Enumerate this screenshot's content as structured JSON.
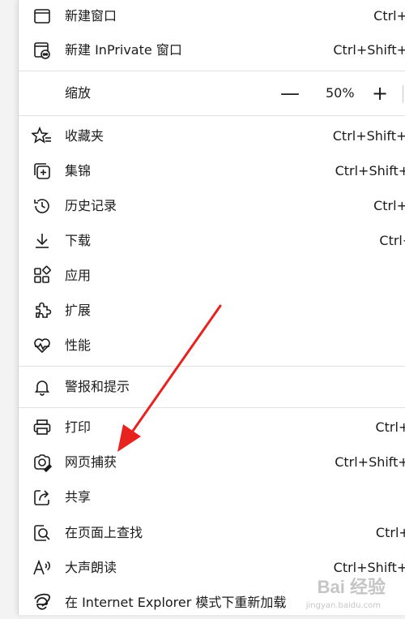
{
  "menu": {
    "items": [
      {
        "label": "新建窗口",
        "shortcut": "Ctrl+N",
        "icon": "new-window-icon"
      },
      {
        "label": "新建 InPrivate 窗口",
        "shortcut": "Ctrl+Shift+N",
        "icon": "inprivate-window-icon"
      },
      {
        "label": "收藏夹",
        "shortcut": "Ctrl+Shift+O",
        "icon": "favorites-icon"
      },
      {
        "label": "集锦",
        "shortcut": "Ctrl+Shift+Y",
        "icon": "collections-icon"
      },
      {
        "label": "历史记录",
        "shortcut": "Ctrl+H",
        "icon": "history-icon"
      },
      {
        "label": "下载",
        "shortcut": "Ctrl+J",
        "icon": "download-icon"
      },
      {
        "label": "应用",
        "shortcut": "",
        "icon": "apps-icon"
      },
      {
        "label": "扩展",
        "shortcut": "",
        "icon": "extensions-icon"
      },
      {
        "label": "性能",
        "shortcut": "",
        "icon": "performance-icon"
      },
      {
        "label": "警报和提示",
        "shortcut": "",
        "icon": "alerts-icon"
      },
      {
        "label": "打印",
        "shortcut": "Ctrl+P",
        "icon": "print-icon"
      },
      {
        "label": "网页捕获",
        "shortcut": "Ctrl+Shift+S",
        "icon": "web-capture-icon"
      },
      {
        "label": "共享",
        "shortcut": "",
        "icon": "share-icon"
      },
      {
        "label": "在页面上查找",
        "shortcut": "Ctrl+F",
        "icon": "find-icon"
      },
      {
        "label": "大声朗读",
        "shortcut": "Ctrl+Shift+U",
        "icon": "read-aloud-icon"
      },
      {
        "label": "在 Internet Explorer 模式下重新加载",
        "shortcut": "",
        "icon": "ie-mode-icon"
      }
    ],
    "zoom": {
      "label": "缩放",
      "minus": "—",
      "value": "50%",
      "plus": "+"
    }
  },
  "annotation": {
    "arrow_color": "#e8231f"
  },
  "watermark": {
    "text": "Bai 经验",
    "sub": "jingyan.baidu.com"
  }
}
